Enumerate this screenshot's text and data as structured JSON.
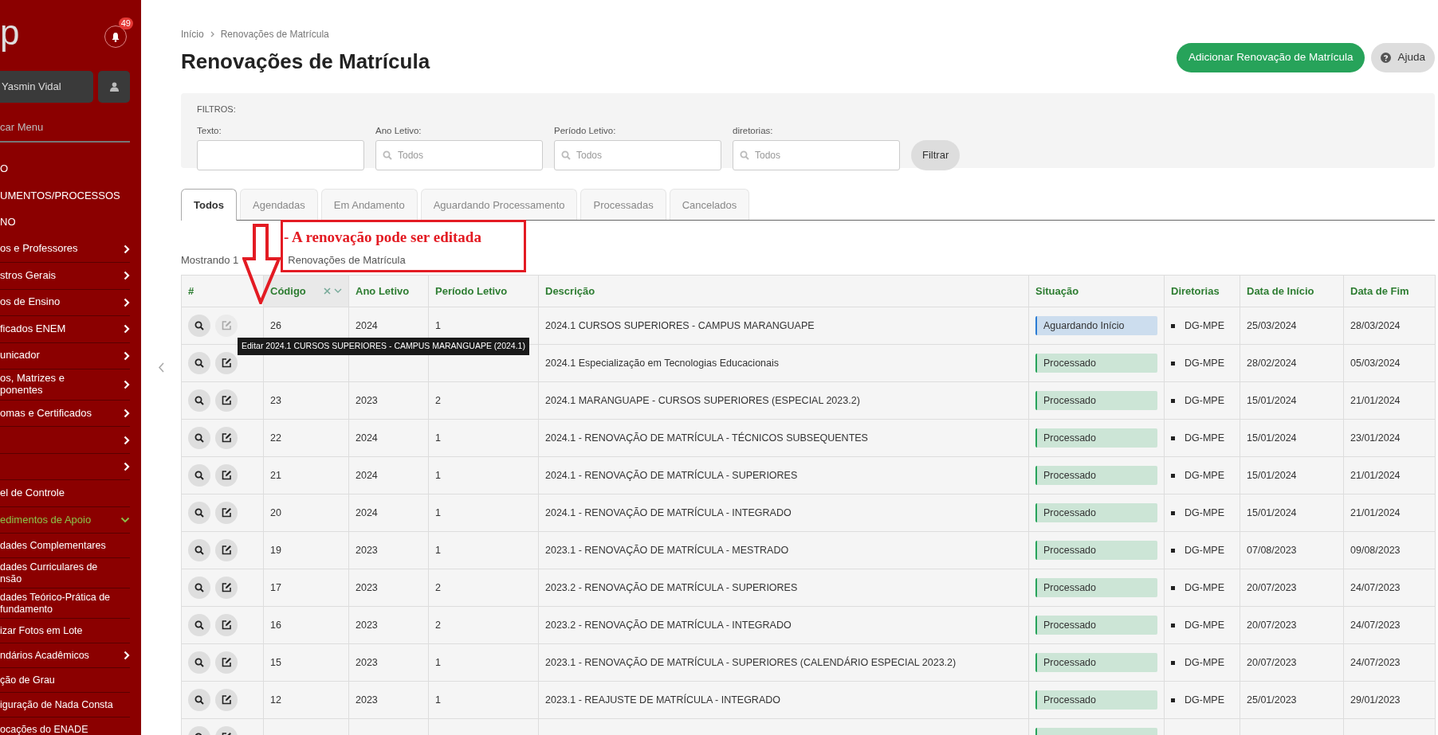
{
  "sidebar": {
    "logo": "p",
    "notifications": "49",
    "user": "Yasmin Vidal",
    "menu_search": {
      "placeholder": "car Menu"
    },
    "items": [
      {
        "label": "O",
        "kind": "heading"
      },
      {
        "label": "UMENTOS/PROCESSOS",
        "kind": "heading"
      },
      {
        "label": "NO",
        "kind": "heading"
      },
      {
        "label": "os e Professores",
        "kind": "submenu",
        "expanded": false
      },
      {
        "label": "stros Gerais",
        "kind": "submenu",
        "expanded": false
      },
      {
        "label": "os de Ensino",
        "kind": "submenu",
        "expanded": false
      },
      {
        "label": "ficados ENEM",
        "kind": "submenu",
        "expanded": false
      },
      {
        "label": "unicador",
        "kind": "submenu",
        "expanded": false
      },
      {
        "label": "os, Matrizes e\nponentes",
        "kind": "submenu",
        "expanded": false
      },
      {
        "label": "omas e Certificados",
        "kind": "submenu",
        "expanded": false
      },
      {
        "kind": "submenu",
        "expanded": false
      },
      {
        "kind": "submenu",
        "expanded": false
      },
      {
        "label": "el de Controle",
        "kind": "link"
      },
      {
        "label": "edimentos de Apoio",
        "kind": "submenu",
        "expanded": true,
        "children": [
          {
            "label": "dades Complementares",
            "kind": "link"
          },
          {
            "label": "dades Curriculares de\nnsão",
            "kind": "link"
          },
          {
            "label": "dades Teórico-Prática de\nfundamento",
            "kind": "link"
          },
          {
            "label": "izar Fotos em Lote",
            "kind": "link"
          },
          {
            "label": "ndários Acadêmicos",
            "kind": "submenu",
            "expanded": false
          },
          {
            "label": "ção de Grau",
            "kind": "link"
          },
          {
            "label": "iguração de Nada Consta",
            "kind": "link"
          },
          {
            "label": "ocações do ENADE",
            "kind": "link"
          }
        ]
      }
    ]
  },
  "breadcrumb": [
    "Início",
    "Renovações de Matrícula"
  ],
  "title": "Renovações de Matrícula",
  "actions": {
    "add": "Adicionar Renovação de Matrícula",
    "help": "Ajuda"
  },
  "filters": {
    "legend": "FILTROS:",
    "fields": [
      {
        "label": "Texto:",
        "kind": "text"
      },
      {
        "label": "Ano Letivo:",
        "kind": "select",
        "placeholder": "Todos"
      },
      {
        "label": "Período Letivo:",
        "kind": "select",
        "placeholder": "Todos"
      },
      {
        "label": "diretorias:",
        "kind": "select",
        "placeholder": "Todos"
      }
    ],
    "button": "Filtrar"
  },
  "tabs": [
    {
      "label": "Todos",
      "selected": true
    },
    {
      "label": "Agendadas",
      "selected": false
    },
    {
      "label": "Em Andamento",
      "selected": false
    },
    {
      "label": "Aguardando Processamento",
      "selected": false
    },
    {
      "label": "Processadas",
      "selected": false
    },
    {
      "label": "Cancelados",
      "selected": false
    }
  ],
  "annotation": {
    "text": "- A renovação pode ser editada"
  },
  "result_count": {
    "before": "Mostrando 1",
    "after": "Renovações de Matrícula"
  },
  "table": {
    "columns": [
      {
        "label": "#",
        "sorted": false
      },
      {
        "label": "Código",
        "sorted": true
      },
      {
        "label": "Ano Letivo",
        "sorted": false
      },
      {
        "label": "Período Letivo",
        "sorted": false
      },
      {
        "label": "Descrição",
        "sorted": false
      },
      {
        "label": "Situação",
        "sorted": false
      },
      {
        "label": "Diretorias",
        "sorted": false
      },
      {
        "label": "Data de Início",
        "sorted": false
      },
      {
        "label": "Data de Fim",
        "sorted": false
      }
    ],
    "tooltip": "Editar 2024.1 CURSOS SUPERIORES - CAMPUS MARANGUAPE (2024.1)",
    "rows": [
      {
        "code": "26",
        "year": "2024",
        "period": "1",
        "description": "2024.1 CURSOS SUPERIORES - CAMPUS MARANGUAPE",
        "status": "Aguardando Início",
        "color": "#2a7bd4",
        "directorate": "DG-MPE",
        "start": "25/03/2024",
        "end": "28/03/2024",
        "edit_hovered": true
      },
      {
        "description": "2024.1 Especialização em Tecnologias Educacionais",
        "status": "Processado",
        "color": "#27a35a",
        "directorate": "DG-MPE",
        "start": "28/02/2024",
        "end": "05/03/2024",
        "edit_hovered": false
      },
      {
        "code": "23",
        "year": "2023",
        "period": "2",
        "description": "2024.1 MARANGUAPE - CURSOS SUPERIORES (ESPECIAL 2023.2)",
        "status": "Processado",
        "color": "#27a35a",
        "directorate": "DG-MPE",
        "start": "15/01/2024",
        "end": "21/01/2024",
        "edit_hovered": false
      },
      {
        "code": "22",
        "year": "2024",
        "period": "1",
        "description": "2024.1 - RENOVAÇÃO DE MATRÍCULA - TÉCNICOS SUBSEQUENTES",
        "status": "Processado",
        "color": "#27a35a",
        "directorate": "DG-MPE",
        "start": "15/01/2024",
        "end": "23/01/2024",
        "edit_hovered": false
      },
      {
        "code": "21",
        "year": "2024",
        "period": "1",
        "description": "2024.1 - RENOVAÇÃO DE MATRÍCULA - SUPERIORES",
        "status": "Processado",
        "color": "#27a35a",
        "directorate": "DG-MPE",
        "start": "15/01/2024",
        "end": "21/01/2024",
        "edit_hovered": false
      },
      {
        "code": "20",
        "year": "2024",
        "period": "1",
        "description": "2024.1 - RENOVAÇÃO DE MATRÍCULA - INTEGRADO",
        "status": "Processado",
        "color": "#27a35a",
        "directorate": "DG-MPE",
        "start": "15/01/2024",
        "end": "21/01/2024",
        "edit_hovered": false
      },
      {
        "code": "19",
        "year": "2023",
        "period": "1",
        "description": "2023.1 - RENOVAÇÃO DE MATRÍCULA - MESTRADO",
        "status": "Processado",
        "color": "#27a35a",
        "directorate": "DG-MPE",
        "start": "07/08/2023",
        "end": "09/08/2023",
        "edit_hovered": false
      },
      {
        "code": "17",
        "year": "2023",
        "period": "2",
        "description": "2023.2 - RENOVAÇÃO DE MATRÍCULA - SUPERIORES",
        "status": "Processado",
        "color": "#27a35a",
        "directorate": "DG-MPE",
        "start": "20/07/2023",
        "end": "24/07/2023",
        "edit_hovered": false
      },
      {
        "code": "16",
        "year": "2023",
        "period": "2",
        "description": "2023.2 - RENOVAÇÃO DE MATRÍCULA - INTEGRADO",
        "status": "Processado",
        "color": "#27a35a",
        "directorate": "DG-MPE",
        "start": "20/07/2023",
        "end": "24/07/2023",
        "edit_hovered": false
      },
      {
        "code": "15",
        "year": "2023",
        "period": "1",
        "description": "2023.1 - RENOVAÇÃO DE MATRÍCULA - SUPERIORES (CALENDÁRIO ESPECIAL 2023.2)",
        "status": "Processado",
        "color": "#27a35a",
        "directorate": "DG-MPE",
        "start": "20/07/2023",
        "end": "24/07/2023",
        "edit_hovered": false
      },
      {
        "code": "12",
        "year": "2023",
        "period": "1",
        "description": "2023.1 - REAJUSTE DE MATRÍCULA - INTEGRADO",
        "status": "Processado",
        "color": "#27a35a",
        "directorate": "DG-MPE",
        "start": "25/01/2023",
        "end": "29/01/2023",
        "edit_hovered": false
      },
      {
        "color": "#27a35a",
        "edit_hovered": false
      }
    ]
  }
}
